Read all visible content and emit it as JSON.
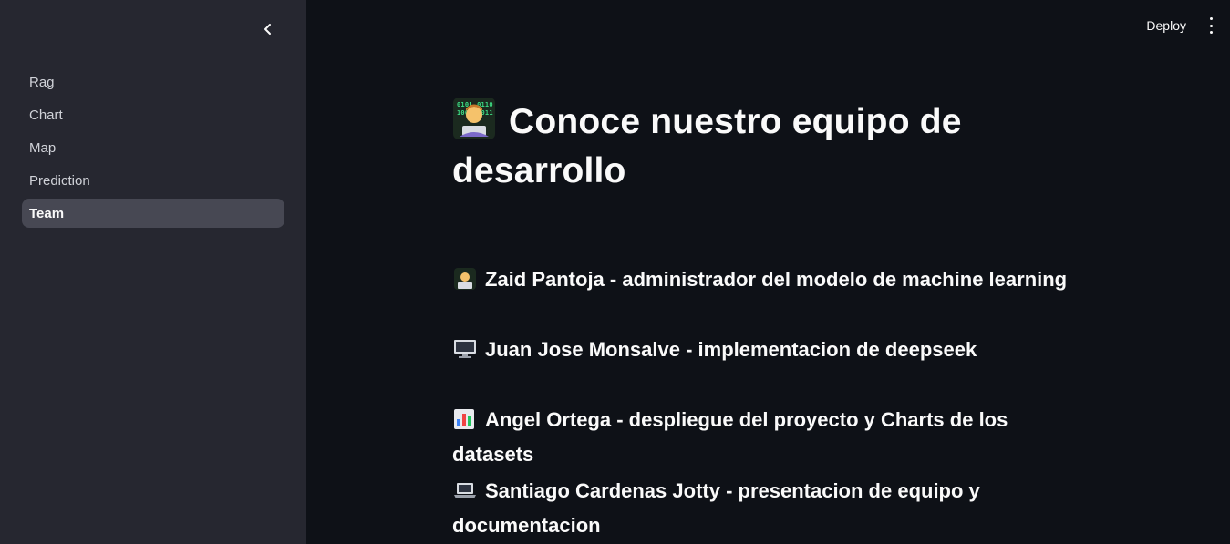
{
  "sidebar": {
    "items": [
      {
        "label": "Rag",
        "active": false
      },
      {
        "label": "Chart",
        "active": false
      },
      {
        "label": "Map",
        "active": false
      },
      {
        "label": "Prediction",
        "active": false
      },
      {
        "label": "Team",
        "active": true
      }
    ]
  },
  "header": {
    "deploy_label": "Deploy",
    "menu_icon": "kebab-menu-icon",
    "collapse_icon": "chevron-left-icon"
  },
  "main": {
    "title": "Conoce nuestro equipo de desarrollo",
    "title_icon": "technologist-icon",
    "members": [
      {
        "icon": "technologist-icon",
        "text": "Zaid Pantoja - administrador del modelo de machine learning"
      },
      {
        "icon": "desktop-computer-icon",
        "text": "Juan Jose Monsalve - implementacion de deepseek"
      },
      {
        "icon": "bar-chart-icon",
        "text": "Angel Ortega - despliegue del proyecto y Charts de los datasets"
      },
      {
        "icon": "laptop-icon",
        "text": "Santiago Cardenas Jotty - presentacion de equipo y documentacion"
      }
    ]
  },
  "colors": {
    "sidebar_bg": "#262730",
    "main_bg": "#0e1117",
    "active_item_bg": "#474853",
    "text": "#fafafa"
  }
}
